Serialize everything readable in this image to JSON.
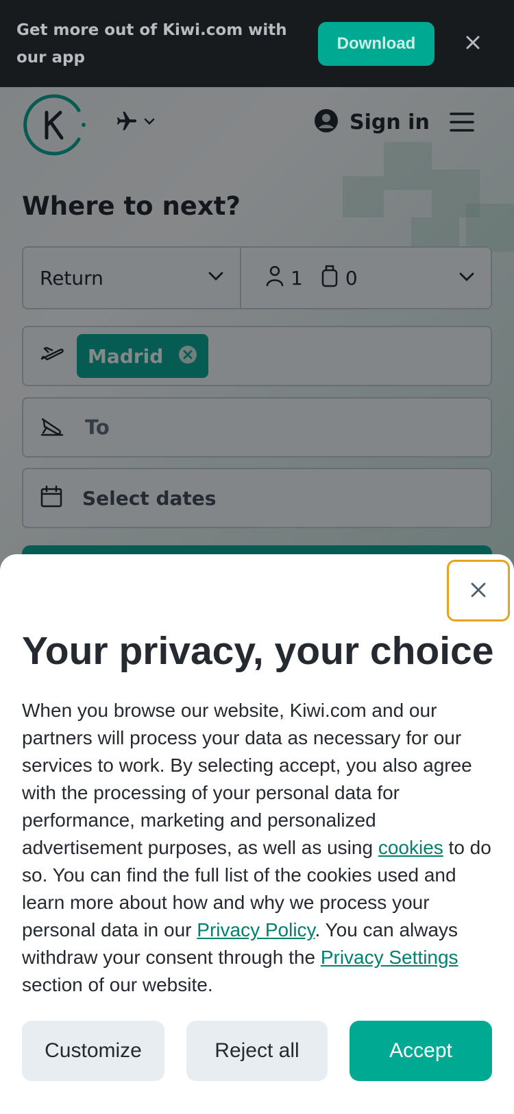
{
  "banner": {
    "text": "Get more out of Kiwi.com with our app",
    "download_label": "Download",
    "close_icon": "close-icon"
  },
  "header": {
    "logo_icon": "kiwi-logo",
    "mode_icon": "airplane-icon",
    "signin_label": "Sign in",
    "menu_icon": "hamburger-menu-icon"
  },
  "search": {
    "headline": "Where to next?",
    "trip_type": "Return",
    "passengers": "1",
    "bags": "0",
    "from_chip": "Madrid",
    "to_placeholder": "To",
    "dates_placeholder": "Select dates"
  },
  "privacy": {
    "title": "Your privacy, your choice",
    "body_part1": "When you browse our website, Kiwi.com and our partners will process your data as necessary for our services to work. By selecting accept, you also agree with the processing of your personal data for performance, marketing and personalized advertisement purposes, as well as using ",
    "link_cookies": "cookies",
    "body_part2": " to do so. You can find the full list of the cookies used and learn more about how and why we process your personal data in our ",
    "link_privacy_policy": "Privacy Policy",
    "body_part3": ". You can always withdraw your consent through the ",
    "link_privacy_settings": "Privacy Settings",
    "body_part4": " section of our website.",
    "customize_label": "Customize",
    "reject_label": "Reject all",
    "accept_label": "Accept"
  },
  "colors": {
    "brand": "#00a991",
    "banner_bg": "#171b1e",
    "link": "#007f6d",
    "focus_ring": "#e8a21c"
  }
}
